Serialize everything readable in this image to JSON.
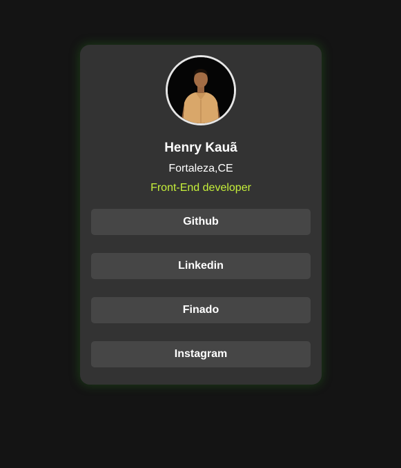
{
  "profile": {
    "name": "Henry Kauã",
    "location": "Fortaleza,CE",
    "role": "Front-End developer",
    "avatar_icon": "profile-photo"
  },
  "links": [
    {
      "label": "Github"
    },
    {
      "label": "Linkedin"
    },
    {
      "label": "Finado"
    },
    {
      "label": "Instagram"
    }
  ],
  "colors": {
    "background": "#141414",
    "card": "#333333",
    "button": "#464646",
    "accent": "#c6f03a",
    "glow": "#28781e"
  }
}
